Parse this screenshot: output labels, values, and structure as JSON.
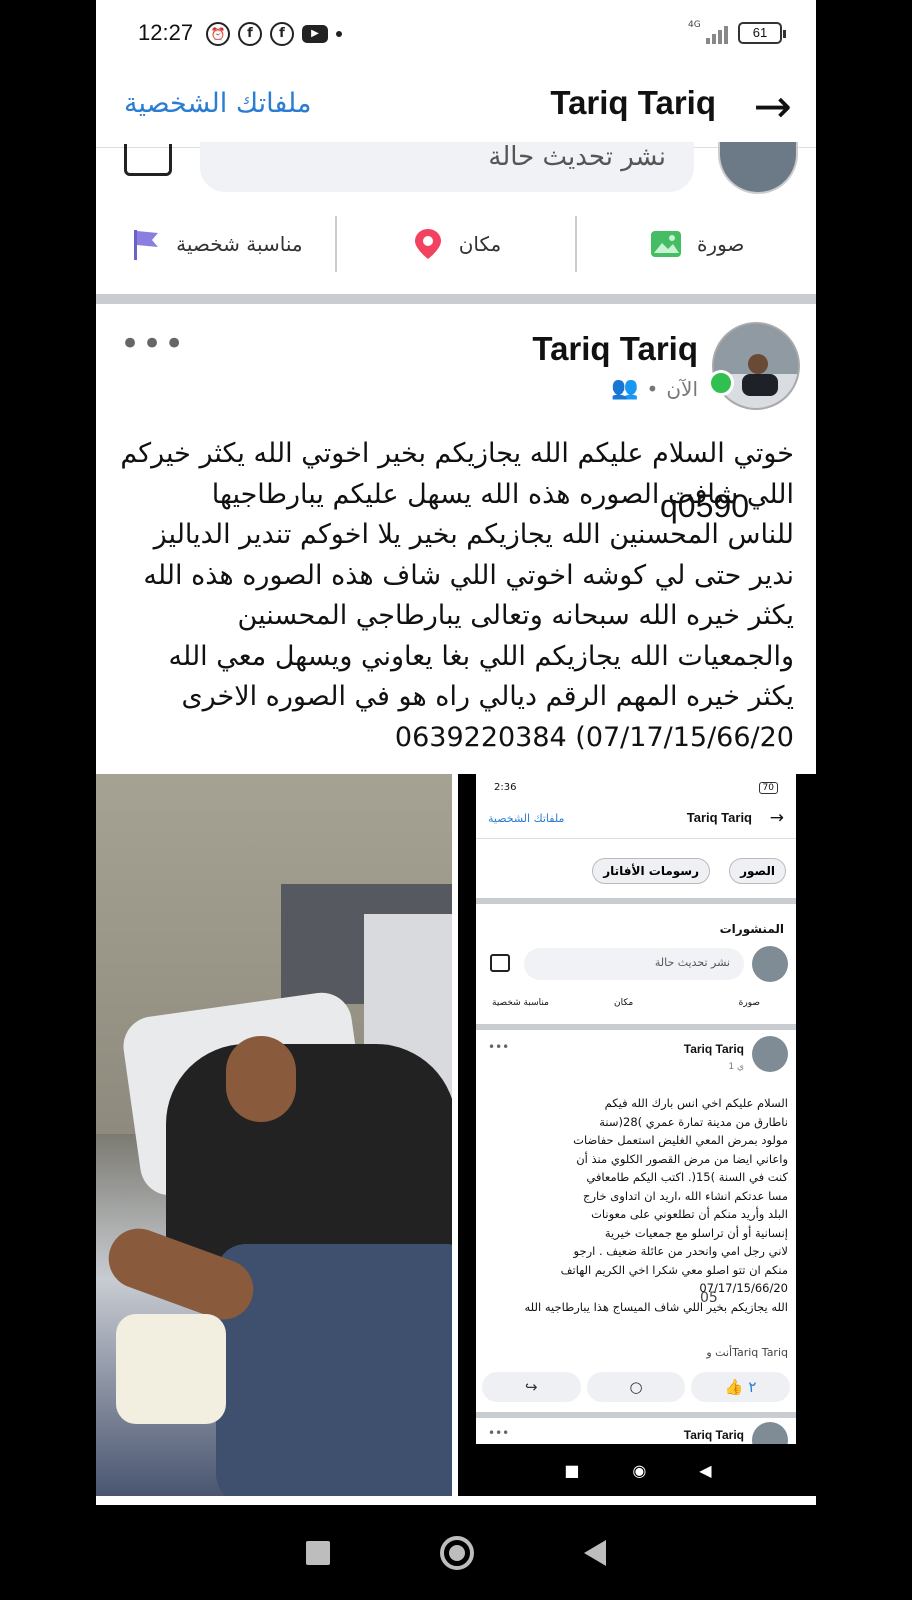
{
  "status_bar": {
    "time": "12:27",
    "network": "4G",
    "battery": "61",
    "notif_icons": [
      "alarm-icon",
      "facebook-icon",
      "facebook-icon",
      "youtube-icon"
    ]
  },
  "header": {
    "title": "Tariq Tariq",
    "link": "ملفاتك الشخصية"
  },
  "composer": {
    "placeholder": "نشر تحديث حالة",
    "actions": [
      {
        "label": "صورة",
        "icon": "photo-icon",
        "color": "#45bd62"
      },
      {
        "label": "مكان",
        "icon": "location-pin-icon",
        "color": "#f3425f"
      },
      {
        "label": "مناسبة شخصية",
        "icon": "flag-icon",
        "color": "#7b6fd6"
      }
    ]
  },
  "post": {
    "author": "Tariq Tariq",
    "time": "الآن",
    "more": "•••",
    "lines": [
      "خوتي السلام عليكم الله يجازيكم بخير اخوتي الله يكثر خيركم",
      "اللي شافت الصوره هذه الله يسهل عليكم يبارطاجيها",
      "للناس المحسنين الله يجازيكم بخير يلا اخوكم تندير الدياليز",
      "ندير حتى لي كوشه اخوتي اللي شاف هذه الصوره هذه الله",
      "يكثر خيره الله سبحانه وتعالى يبارطاجي المحسنين",
      "والجمعيات الله يجازيكم اللي بغا يعاوني ويسهل معي الله",
      "يكثر خيره المهم الرقم ديالي راه هو في الصوره الاخرى",
      "0639220384 (07/17/15/66/20"
    ]
  },
  "embedded_screenshot": {
    "time": "2:36",
    "battery": "70",
    "title": "Tariq Tariq",
    "link": "ملفاتك الشخصية",
    "tabs": [
      "الصور",
      "رسومات الأفاتار"
    ],
    "section": "المنشورات",
    "placeholder": "نشر تحديث حالة",
    "actions": [
      "صورة",
      "مكان",
      "مناسبة شخصية"
    ],
    "post_author": "Tariq Tariq",
    "post_time": "1 ي",
    "post_lines": [
      "السلام عليكم اخي انس بارك الله فيكم",
      "ناطارق من مدينة تمارة عمري )28(سنة",
      "مولود بمرض المعي الغليض استعمل حفاضات",
      "واعاني ايضا من مرض القصور الكلوي منذ أن",
      "كنت في السنة )15(. اكتب اليكم طامعافي",
      "مسا عدتكم انشاء الله ،اريد ان اتداوى خارج",
      "البلد وأريد منكم أن تطلعوني على معونات",
      "إنسانية أو أن تراسلو مع جمعيات خيرية",
      "لاني رجل امي وانحدر من عائلة ضعيف . ارجو",
      "منكم ان تتو اصلو معي شكرا اخي الكريم الهاتف",
      "07/17/15/66/20",
      "الله يجازيكم بخير اللي شاف الميساج هذا يبارطاجيه الله"
    ],
    "reactions": "أنت وTariq Tariq",
    "like_count": "٢",
    "next_author": "Tariq Tariq"
  },
  "watermark": "q0590",
  "watermark2": "05"
}
